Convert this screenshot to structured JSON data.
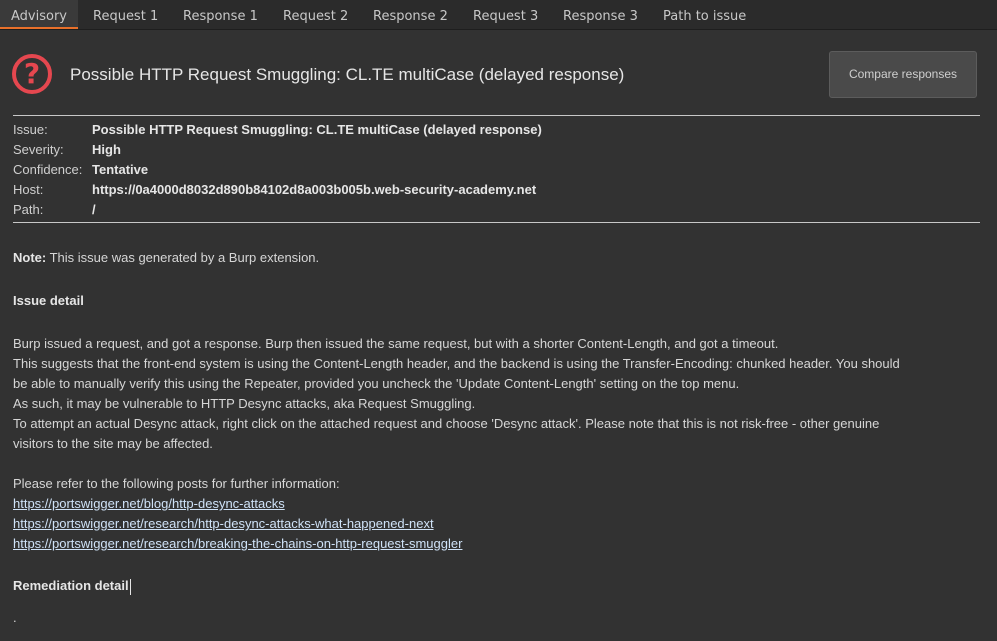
{
  "tabs": [
    {
      "label": "Advisory",
      "active": true
    },
    {
      "label": "Request 1"
    },
    {
      "label": "Response 1"
    },
    {
      "label": "Request 2"
    },
    {
      "label": "Response 2"
    },
    {
      "label": "Request 3"
    },
    {
      "label": "Response 3"
    },
    {
      "label": "Path to issue"
    }
  ],
  "header": {
    "icon": "question-icon",
    "icon_glyph": "?",
    "title": "Possible HTTP Request Smuggling: CL.TE multiCase (delayed response)",
    "compare_label": "Compare responses"
  },
  "details": {
    "issue_label": "Issue:",
    "issue": "Possible HTTP Request Smuggling: CL.TE multiCase (delayed response)",
    "severity_label": "Severity:",
    "severity": "High",
    "confidence_label": "Confidence:",
    "confidence": "Tentative",
    "host_label": "Host:",
    "host": "https://0a4000d8032d890b84102d8a003b005b.web-security-academy.net",
    "path_label": "Path:",
    "path": "/"
  },
  "note": {
    "label": "Note:",
    "text": " This issue was generated by a Burp extension."
  },
  "issue_detail": {
    "heading": "Issue detail",
    "lines": [
      "Burp issued a request, and got a response. Burp then issued the same request, but with a shorter Content-Length, and got a timeout.",
      "This suggests that the front-end system is using the Content-Length header, and the backend is using the Transfer-Encoding: chunked header. You should",
      "be able to manually verify this using the Repeater, provided you uncheck the 'Update Content-Length' setting on the top menu.",
      "As such, it may be vulnerable to HTTP Desync attacks, aka Request Smuggling.",
      "To attempt an actual Desync attack, right click on the attached request and choose 'Desync attack'. Please note that this is not risk-free - other genuine",
      "visitors to the site may be affected."
    ],
    "refer_text": "Please refer to the following posts for further information:",
    "links": [
      "https://portswigger.net/blog/http-desync-attacks",
      "https://portswigger.net/research/http-desync-attacks-what-happened-next",
      "https://portswigger.net/research/breaking-the-chains-on-http-request-smuggler"
    ]
  },
  "remediation": {
    "heading": "Remediation detail",
    "text": "."
  },
  "colors": {
    "accent": "#e8702a",
    "severity_icon": "#e5474f",
    "background": "#323232",
    "link": "#cfe2f7"
  }
}
